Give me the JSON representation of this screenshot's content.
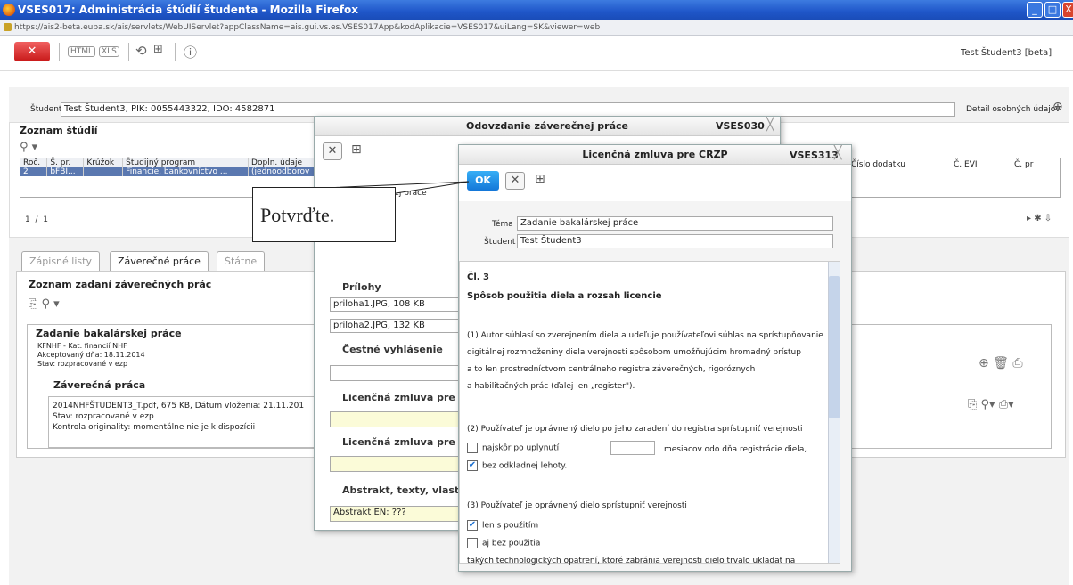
{
  "window": {
    "title": "VSES017: Administrácia štúdií študenta - Mozilla Firefox",
    "min": "_",
    "max": "□",
    "close": "X"
  },
  "browser": {
    "url": "https://ais2-beta.euba.sk/ais/servlets/WebUIServlet?appClassName=ais.gui.vs.es.VSES017App&kodAplikacie=VSES017&uiLang=SK&viewer=web"
  },
  "toolbar": {
    "close": "✕",
    "html": "HTML",
    "xls": "XLS",
    "refresh": "⟲",
    "tree": "⊞",
    "info": "ⓘ",
    "user": "Test Študent3 [beta]"
  },
  "student": {
    "label": "Študent",
    "value": "Test Študent3, PIK: 0055443322, IDO: 4582871",
    "detail": "Detail osobných údajov"
  },
  "studies": {
    "title": "Zoznam štúdií",
    "columns": [
      "Roč.",
      "Š. pr.",
      "Krúžok",
      "Študijný program",
      "Dopln. údaje"
    ],
    "row": [
      "2",
      "bFBI...",
      "",
      "Financie, bankovníctvo ...",
      "(jednoodborov"
    ],
    "right_columns": [
      "Číslo dodatku",
      "Č. EVI",
      "Č. pr"
    ],
    "pager": [
      "1",
      "/",
      "1"
    ]
  },
  "tabs": [
    "Zápisné listy",
    "Záverečné práce",
    "Štátne"
  ],
  "theses": {
    "title": "Zoznam zadaní záverečných prác",
    "assignment": {
      "title": "Zadanie bakalárskej práce",
      "lines": [
        "KFNHF - Kat. financií NHF",
        "Akceptovaný dňa: 18.11.2014",
        "Stav: rozpracované v ezp"
      ]
    },
    "work": {
      "title": "Záverečná práca",
      "lines": [
        "2014NHFŠTUDENT3_T.pdf, 675 KB, Dátum vloženia: 21.11.201",
        "Stav: rozpracované v ezp",
        "Kontrola originality: momentálne nie je k dispozícii"
      ]
    }
  },
  "dialog1": {
    "title": "Odovzdanie záverečnej práce",
    "code": "VSES030",
    "kod_label": "Kód záverečnej práce",
    "attachments": "Prílohy",
    "files": [
      "priloha1.JPG, 108 KB",
      "priloha2.JPG, 132 KB"
    ],
    "honor": "Čestné vyhlásenie",
    "lic1": "Licenčná zmluva pre CR",
    "lic2": "Licenčná zmluva pre vy",
    "abstract": "Abstrakt, texty, vlastno",
    "abstract_val": "Abstrakt EN: ???"
  },
  "dialog2": {
    "title": "Licenčná zmluva pre CRZP",
    "code": "VSES313",
    "ok": "OK",
    "tema_label": "Téma",
    "tema": "Zadanie bakalárskej práce",
    "student_label": "Študent",
    "student": "Test Študent3",
    "article": "Čl. 3",
    "heading": "Spôsob použitia diela a rozsah licencie",
    "p1": [
      "(1) Autor súhlasí so zverejnením diela a udeľuje používateľovi súhlas na sprístupňovanie",
      "digitálnej rozmnoženiny diela verejnosti spôsobom umožňujúcim hromadný prístup",
      "a to len prostredníctvom centrálneho registra záverečných, rigoróznych",
      "a habilitačných prác (ďalej len „register\")."
    ],
    "p2": "(2) Používateľ je oprávnený dielo po jeho zaradení do registra sprístupniť verejnosti",
    "opt1a": "najskôr po uplynutí",
    "opt1b": "mesiacov odo dňa registrácie diela,",
    "opt2": "bez odkladnej lehoty.",
    "p3": "(3) Používateľ je oprávnený dielo sprístupniť verejnosti",
    "opt3": "len s použitím",
    "opt4": "aj bez použitia",
    "p4": "takých technologických opatrení, ktoré zabránia verejnosti dielo trvalo ukladať na"
  },
  "callout": "Potvrďte."
}
